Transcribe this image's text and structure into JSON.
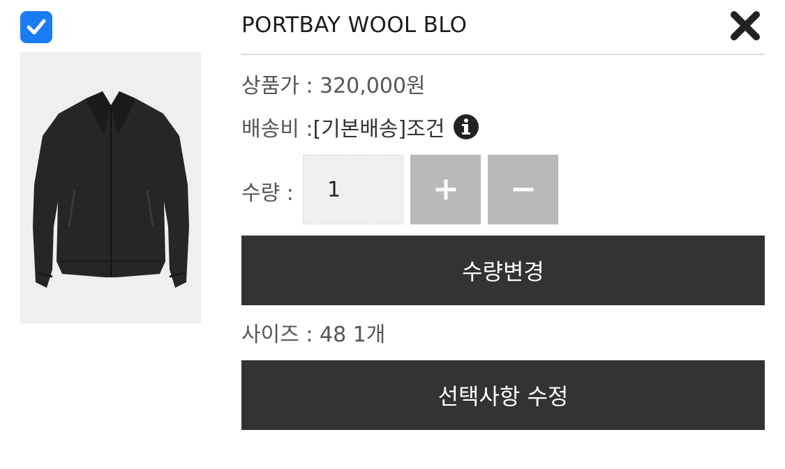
{
  "product": {
    "name": "PORTBAY WOOL BLO",
    "selected": true
  },
  "price": {
    "label": "상품가 : ",
    "value": "320,000원"
  },
  "shipping": {
    "label": "배송비 : ",
    "value": "[기본배송]조건"
  },
  "quantity": {
    "label": "수량 : ",
    "value": "1",
    "plus": "+",
    "minus": "−"
  },
  "buttons": {
    "change_quantity": "수량변경",
    "edit_options": "선택사항 수정"
  },
  "option": {
    "text": "사이즈 : 48 1개"
  },
  "colors": {
    "accent": "#1a7cf5",
    "dark_button": "#333333",
    "qty_button": "#b9b9b9"
  },
  "icons": [
    "check-icon",
    "close-icon",
    "info-icon",
    "plus-icon",
    "minus-icon"
  ]
}
